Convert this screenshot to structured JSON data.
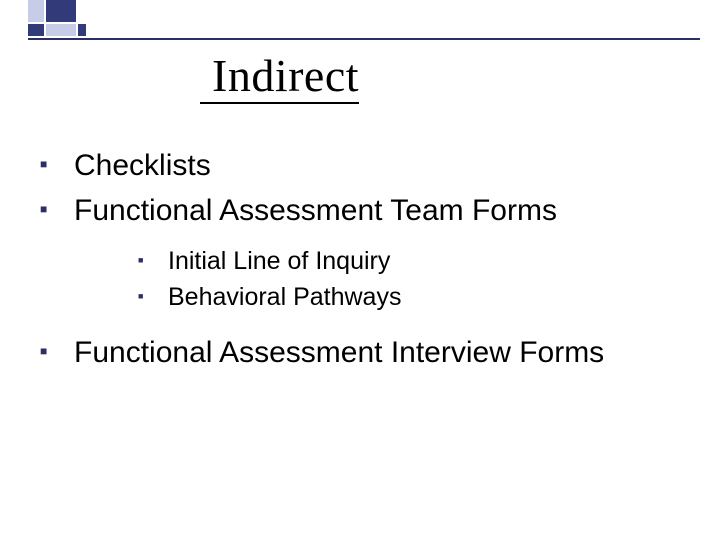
{
  "title": " Indirect",
  "bullets_l1_a": [
    "Checklists",
    "Functional Assessment Team Forms"
  ],
  "bullets_l2": [
    "Initial Line of Inquiry",
    "Behavioral Pathways"
  ],
  "bullets_l1_b": [
    "Functional Assessment Interview Forms"
  ]
}
